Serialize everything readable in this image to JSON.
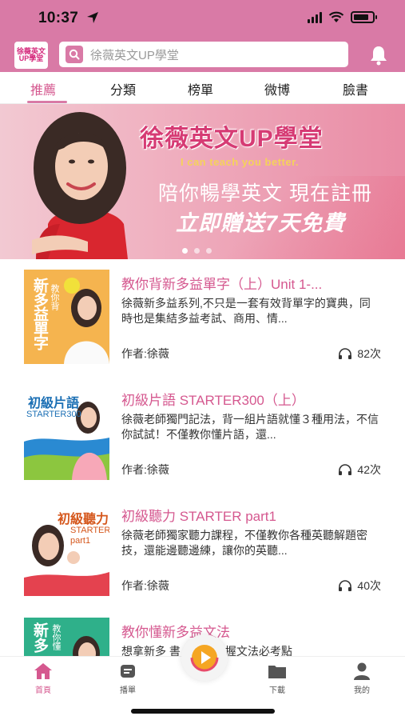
{
  "status_bar": {
    "time": "10:37"
  },
  "header": {
    "logo_line1": "徐薇英文",
    "logo_line2": "UP學堂",
    "search_placeholder": "徐薇英文UP學堂"
  },
  "tabs": [
    {
      "label": "推薦",
      "active": true
    },
    {
      "label": "分類",
      "active": false
    },
    {
      "label": "榜單",
      "active": false
    },
    {
      "label": "微博",
      "active": false
    },
    {
      "label": "臉書",
      "active": false
    }
  ],
  "banner": {
    "title": "徐薇英文UP學堂",
    "tagline": "I can teach you better.",
    "line1": "陪你暢學英文 現在註冊",
    "line2": "立即贈送7天免費",
    "page_count": 3,
    "current_page": 1
  },
  "courses": [
    {
      "title": "教你背新多益單字（上）Unit 1-...",
      "description": "徐薇新多益系列,不只是一套有效背單字的寶典，同時也是集結多益考試、商用、情...",
      "author": "作者:徐薇",
      "plays": "82次",
      "thumb_text": "新多益單字",
      "thumb_sub": "教你背"
    },
    {
      "title": "初級片語 STARTER300（上）",
      "description": "徐薇老師獨門記法，背一組片語就懂３種用法，不信你試試！不僅教你懂片語，還...",
      "author": "作者:徐薇",
      "plays": "42次",
      "thumb_text": "初級片語",
      "thumb_sub": "STARTER300"
    },
    {
      "title": "初級聽力 STARTER part1",
      "description": "徐薇老師獨家聽力課程，不僅教你各種英聽解題密技，還能邊聽邊練，讓你的英聽...",
      "author": "作者:徐薇",
      "plays": "40次",
      "thumb_text": "初級聽力",
      "thumb_sub": "STARTER part1"
    },
    {
      "title": "教你懂新多益文法",
      "description": "想拿新多 書，精準掌握文法必考點",
      "author": "",
      "plays": "",
      "thumb_text": "新多",
      "thumb_sub": "教你懂"
    }
  ],
  "tabbar": [
    {
      "label": "首頁",
      "icon": "home-icon",
      "active": true
    },
    {
      "label": "播單",
      "icon": "playlist-icon",
      "active": false
    },
    {
      "label": "下載",
      "icon": "folder-icon",
      "active": false
    },
    {
      "label": "我的",
      "icon": "person-icon",
      "active": false
    }
  ],
  "colors": {
    "brand_pink": "#d97aa6",
    "accent_text": "#d5588f"
  }
}
